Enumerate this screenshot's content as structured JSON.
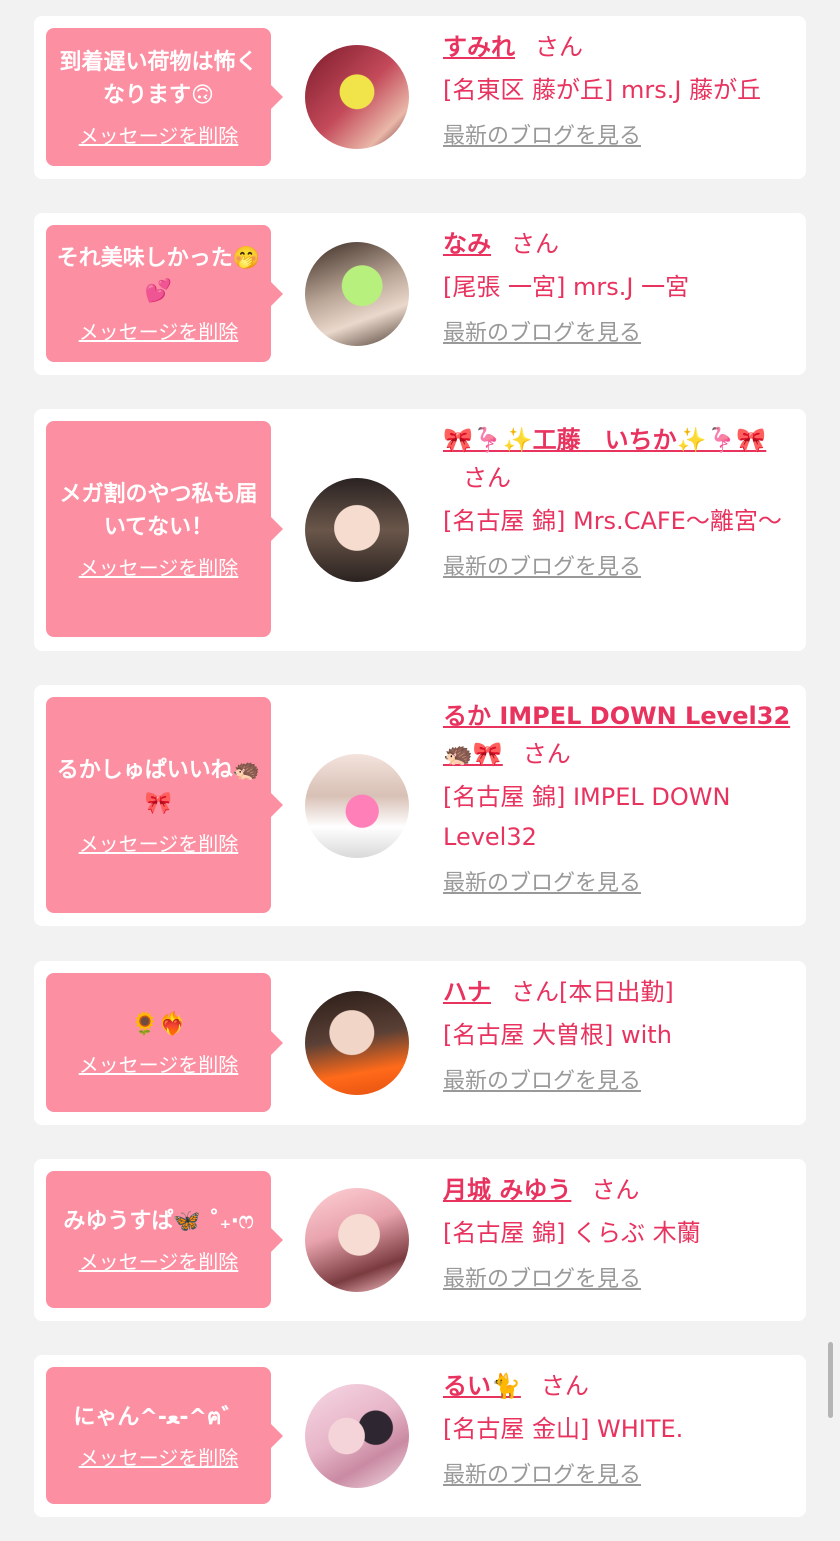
{
  "colors": {
    "background": "#f2f2f2",
    "card": "#ffffff",
    "bubble": "#fd8fa2",
    "accent": "#e8335f",
    "link_gray": "#999999"
  },
  "delete_label": "メッセージを削除",
  "blog_label": "最新のブログを見る",
  "san_label": "さん",
  "cards": [
    {
      "message": "到着遅い荷物は怖くなります🙃",
      "name": "すみれ",
      "status": "",
      "shop": "[名東区 藤が丘] mrs.J 藤が丘"
    },
    {
      "message": "それ美味しかった🤭💕",
      "name": "なみ",
      "status": "",
      "shop": "[尾張 一宮] mrs.J 一宮"
    },
    {
      "message": "メガ割のやつ私も届いてない！",
      "name": "🎀🦩✨工藤　いちか✨🦩🎀",
      "status": "",
      "shop": "[名古屋 錦] Mrs.CAFE〜離宮〜"
    },
    {
      "message": "るかしゅぱいいね🦔🎀",
      "name": "るか IMPEL DOWN Level32 🦔🎀",
      "status": "",
      "shop": "[名古屋 錦] IMPEL DOWN Level32"
    },
    {
      "message": "🌻❤️‍🔥",
      "name": "ハナ",
      "status": "[本日出勤]",
      "shop": "[名古屋 大曽根] with"
    },
    {
      "message": "みゆうすぱ🦋 ˚₊‧ෆ",
      "name": "月城 みゆう",
      "status": "",
      "shop": "[名古屋 錦] くらぶ 木蘭"
    },
    {
      "message": "にゃん^-ﻌ-^ฅ゛",
      "name": "るい🐈",
      "status": "",
      "shop": "[名古屋 金山] WHITE."
    }
  ]
}
